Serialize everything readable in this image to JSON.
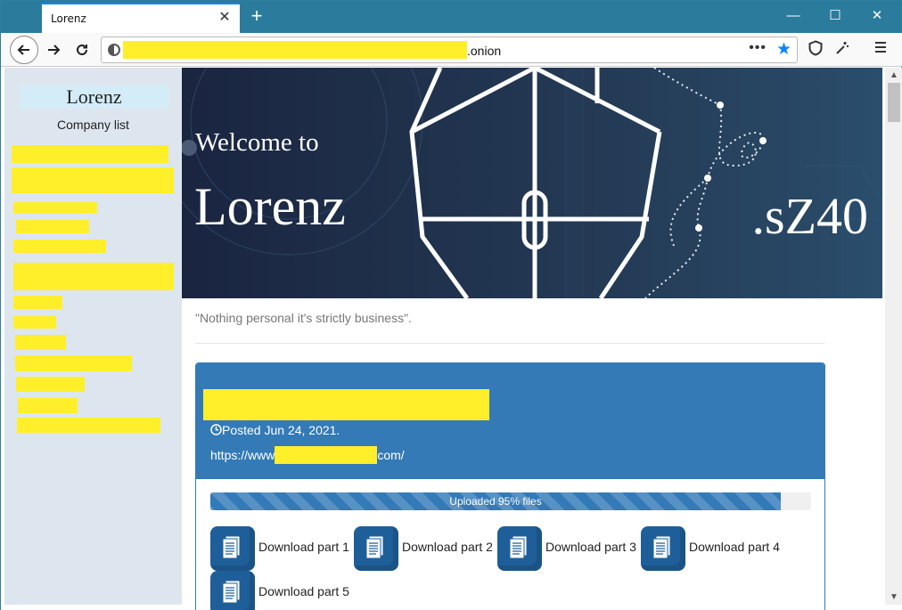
{
  "browser": {
    "tab_title": "Lorenz",
    "tab_close": "✕",
    "new_tab": "+",
    "url_suffix": ".onion",
    "page_actions": "•••",
    "window_controls": {
      "minimize": "—",
      "maximize": "☐",
      "close": "✕"
    }
  },
  "sidebar": {
    "title": "Lorenz",
    "subtitle": "Company list"
  },
  "hero": {
    "welcome": "Welcome to",
    "name": "Lorenz",
    "extension": ".sZ40"
  },
  "quote": "\"Nothing personal it's strictly business\".",
  "post": {
    "posted": "Posted Jun 24, 2021.",
    "url_prefix": "https://www",
    "url_suffix": "com/",
    "progress_label": "Uploaded 95% files",
    "progress_fraction": 0.95,
    "downloads": [
      "Download part 1",
      "Download part 2",
      "Download part 3",
      "Download part 4",
      "Download part 5"
    ]
  },
  "colors": {
    "titlebar": "#2b7c9c",
    "redaction": "#ffef2a",
    "card_blue": "#337ab7",
    "hero_bg": "#1d2940",
    "accent": "#0a84ff"
  },
  "icons": [
    "close-icon",
    "plus-icon",
    "back-arrow-icon",
    "forward-arrow-icon",
    "reload-icon",
    "tor-onion-icon",
    "bookmark-star-icon",
    "shield-icon",
    "magic-wand-icon",
    "hamburger-menu-icon",
    "clock-icon",
    "document-icon"
  ]
}
